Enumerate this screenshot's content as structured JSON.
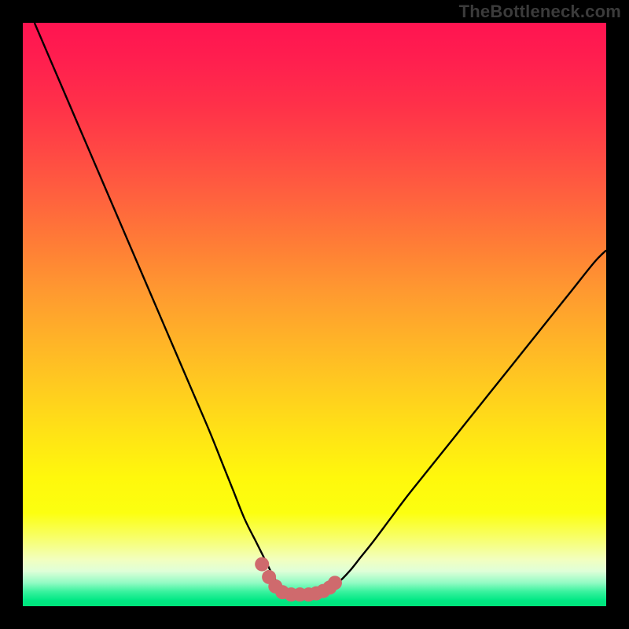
{
  "watermark": "TheBottleneck.com",
  "colors": {
    "page_bg": "#000000",
    "curve_stroke": "#000000",
    "marker_fill": "#cf6a6d",
    "gradient_top": "#ff1450",
    "gradient_bottom": "#00e37a"
  },
  "chart_data": {
    "type": "line",
    "title": "",
    "xlabel": "",
    "ylabel": "",
    "xlim": [
      0,
      100
    ],
    "ylim": [
      0,
      100
    ],
    "grid": false,
    "legend": false,
    "series": [
      {
        "name": "bottleneck-curve",
        "x": [
          2,
          5,
          8,
          11,
          14,
          17,
          20,
          23,
          26,
          29,
          32,
          34,
          36,
          38,
          40,
          41,
          42,
          43,
          44,
          45,
          46,
          47,
          48,
          49,
          50,
          51,
          52,
          54,
          56,
          58,
          60,
          63,
          66,
          70,
          74,
          78,
          82,
          86,
          90,
          94,
          98,
          100
        ],
        "y": [
          100,
          93,
          86,
          79,
          72,
          65,
          58,
          51,
          44,
          37,
          30,
          25,
          20,
          15,
          11,
          9,
          7,
          5,
          3.5,
          2.5,
          2,
          2,
          2,
          2,
          2,
          2.3,
          2.8,
          4,
          6,
          8.5,
          11,
          15,
          19,
          24,
          29,
          34,
          39,
          44,
          49,
          54,
          59,
          61
        ]
      }
    ],
    "markers": [
      {
        "x": 41.0,
        "y": 7.2
      },
      {
        "x": 42.2,
        "y": 5.0
      },
      {
        "x": 43.3,
        "y": 3.4
      },
      {
        "x": 44.5,
        "y": 2.4
      },
      {
        "x": 46.0,
        "y": 2.0
      },
      {
        "x": 47.5,
        "y": 2.0
      },
      {
        "x": 49.0,
        "y": 2.0
      },
      {
        "x": 50.3,
        "y": 2.2
      },
      {
        "x": 51.5,
        "y": 2.6
      },
      {
        "x": 52.6,
        "y": 3.2
      },
      {
        "x": 53.5,
        "y": 4.0
      }
    ]
  }
}
